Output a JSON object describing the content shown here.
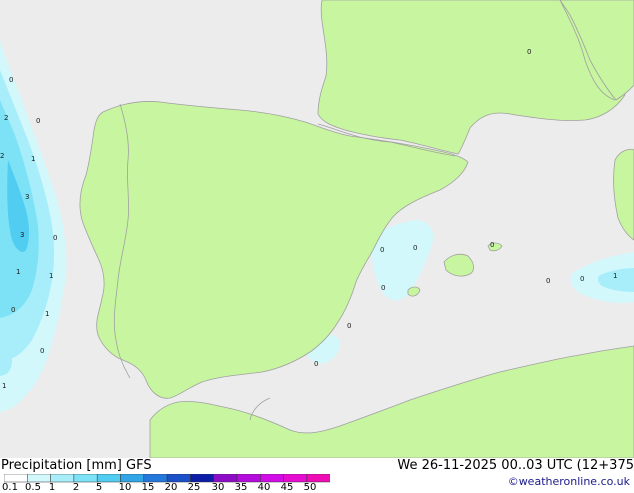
{
  "title": "Precipitation [mm]  GFS",
  "datetime": "We 26-11-2025 00..03 UTC (12+375",
  "credit": "©weatheronline.co.uk",
  "legend": {
    "labels": [
      "0.1",
      "0.5",
      "1",
      "2",
      "5",
      "10",
      "15",
      "20",
      "25",
      "30",
      "35",
      "40",
      "45",
      "50"
    ],
    "colors": [
      "#ffffff",
      "#d2f8fc",
      "#a8eefa",
      "#7ee2f6",
      "#50cdf0",
      "#30a6e6",
      "#2478dc",
      "#1a50c8",
      "#0c1ea8",
      "#8c0cc8",
      "#b40cdc",
      "#d20ce6",
      "#e60cd2",
      "#f00cb4"
    ]
  },
  "colors": {
    "sea": "#ececec",
    "land": "#c8f5a0",
    "border": "#a0a0a0",
    "precip_light": "#d2f8fc",
    "precip_mid": "#a8eefa",
    "precip_heavy": "#7ee2f6",
    "precip_core": "#50cdf0"
  },
  "values": [
    "0",
    "2",
    "0",
    "2",
    "1",
    "3",
    "0",
    "3",
    "1",
    "1",
    "0",
    "1",
    "0",
    "1",
    "0",
    "0",
    "0",
    "0",
    "0",
    "0",
    "0",
    "0",
    "0",
    "1"
  ]
}
